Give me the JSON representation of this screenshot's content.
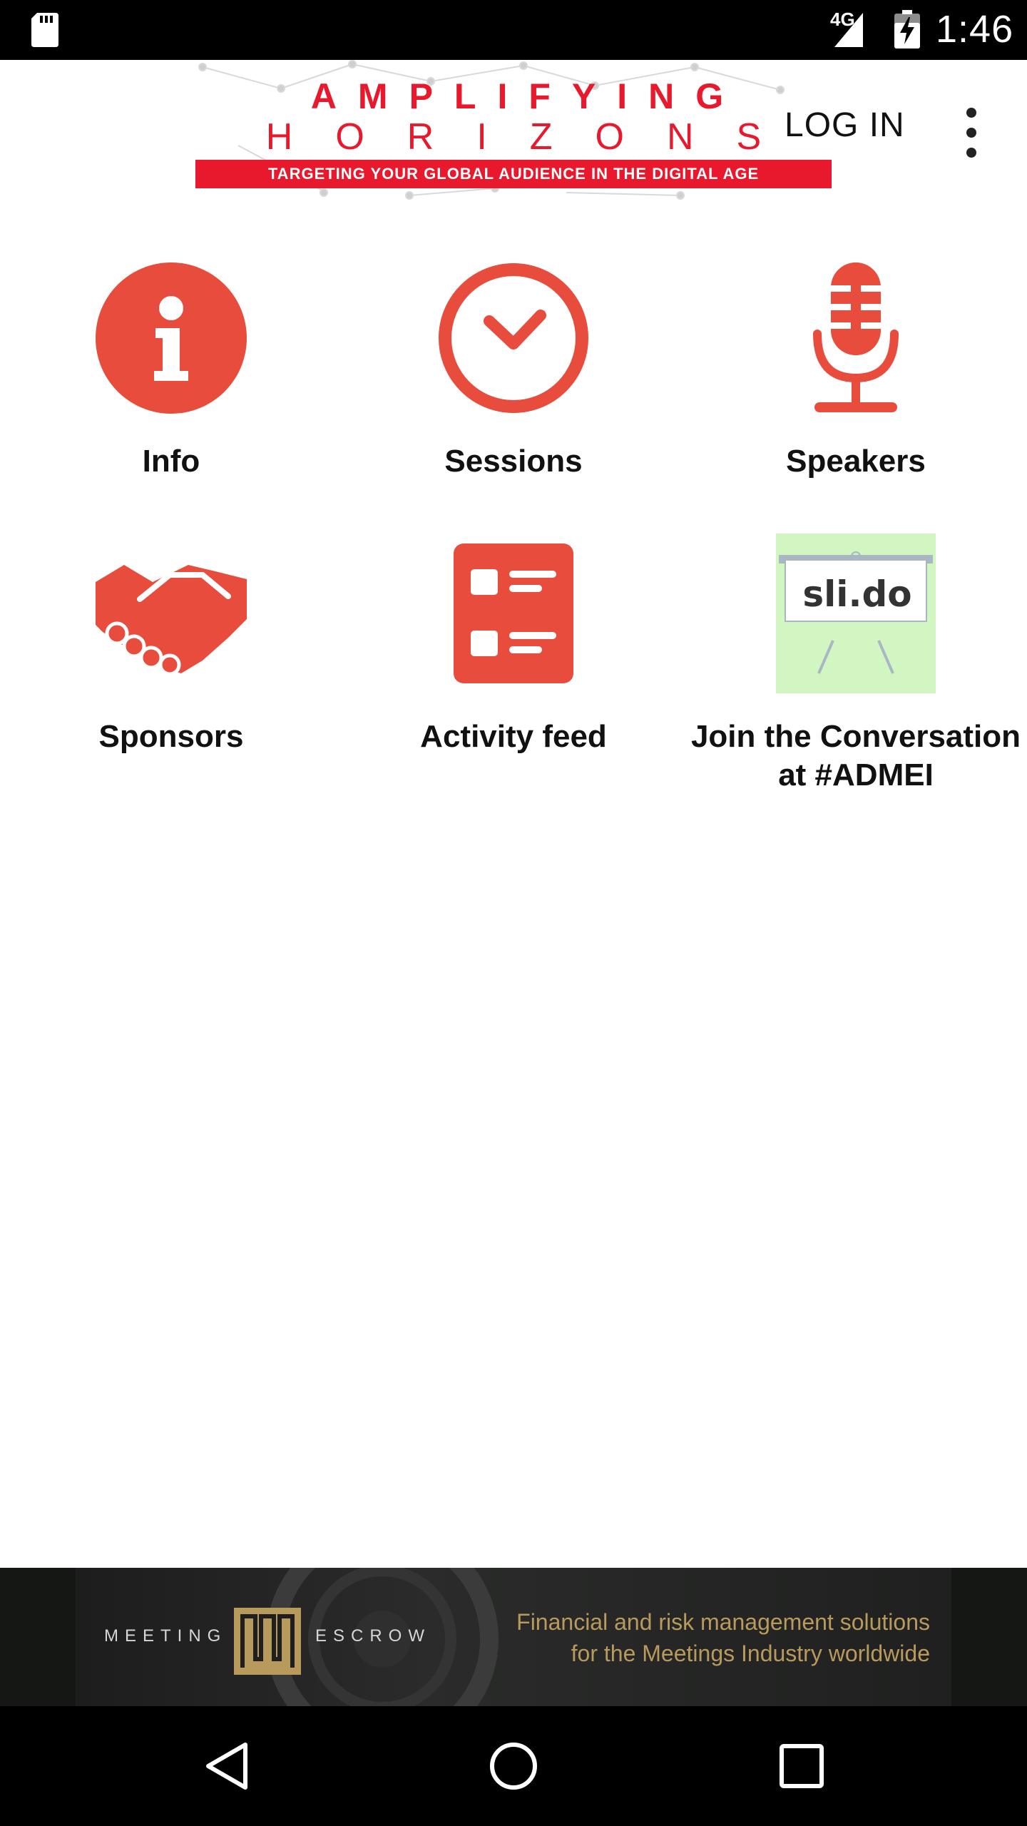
{
  "status_bar": {
    "network": "4G",
    "time": "1:46"
  },
  "app_bar": {
    "logo": {
      "line1": "AMPLIFYING",
      "line2": "HORIZONS",
      "tagline": "TARGETING YOUR GLOBAL AUDIENCE IN THE DIGITAL AGE"
    },
    "login_label": "LOG IN"
  },
  "grid": {
    "items": [
      {
        "label": "Info",
        "icon": "info-icon"
      },
      {
        "label": "Sessions",
        "icon": "clock-icon"
      },
      {
        "label": "Speakers",
        "icon": "microphone-icon"
      },
      {
        "label": "Sponsors",
        "icon": "handshake-icon"
      },
      {
        "label": "Activity feed",
        "icon": "activity-feed-icon"
      },
      {
        "label": "Join the Conversation at #ADMEI",
        "icon": "slido-logo",
        "logo_text": "sli.do"
      }
    ]
  },
  "ad": {
    "brand_left": "MEETING",
    "brand_right": "ESCROW",
    "line1": "Financial and risk management solutions",
    "line2": "for the Meetings Industry worldwide"
  },
  "colors": {
    "accent": "#e74c3c",
    "brand_red": "#e8192c",
    "ad_gold": "#b99a5d",
    "slido_bg": "#d1f6c1"
  }
}
